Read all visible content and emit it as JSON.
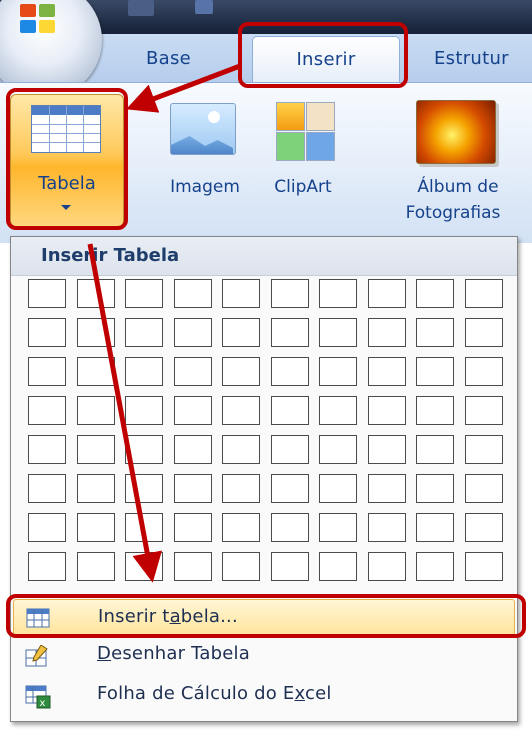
{
  "ribbon": {
    "tabs": [
      {
        "label": "Base"
      },
      {
        "label": "Inserir"
      },
      {
        "label": "Estrutur"
      }
    ],
    "buttons": {
      "tabela": "Tabela",
      "imagem": "Imagem",
      "clipart": "ClipArt",
      "album_line1": "Álbum de",
      "album_line2": "Fotografias"
    }
  },
  "dropdown": {
    "title": "Inserir Tabela",
    "grid": {
      "columns": 10,
      "rows": 8
    },
    "menu": [
      {
        "label_pre": "Inserir t",
        "label_u": "a",
        "label_post": "bela...",
        "icon": "table-grid-icon"
      },
      {
        "label_pre": "",
        "label_u": "D",
        "label_post": "esenhar Tabela",
        "icon": "draw-table-pencil-icon"
      },
      {
        "label_pre": "Folha de Cálculo do E",
        "label_u": "x",
        "label_post": "cel",
        "icon": "excel-sheet-icon"
      }
    ]
  },
  "colors": {
    "annotation": "#c00000",
    "ribbon_text": "#15428b",
    "highlight": "#ffd66b"
  }
}
